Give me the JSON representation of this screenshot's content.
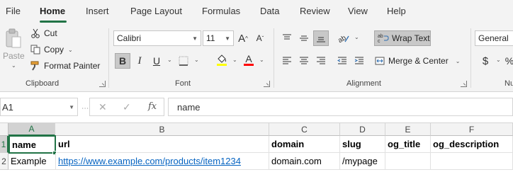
{
  "menu": {
    "tabs": [
      "File",
      "Home",
      "Insert",
      "Page Layout",
      "Formulas",
      "Data",
      "Review",
      "View",
      "Help"
    ],
    "active": "Home"
  },
  "clipboard": {
    "paste": "Paste",
    "cut": "Cut",
    "copy": "Copy",
    "format_painter": "Format Painter",
    "label": "Clipboard"
  },
  "font": {
    "family": "Calibri",
    "size": "11",
    "grow": "A",
    "shrink": "A",
    "bold": "B",
    "italic": "I",
    "underline": "U",
    "font_color_letter": "A",
    "label": "Font",
    "highlight_color": "#ffff00",
    "font_color": "#ff0000"
  },
  "alignment": {
    "wrap_text": "Wrap Text",
    "merge_center": "Merge & Center",
    "label": "Alignment"
  },
  "number": {
    "format": "General",
    "currency_symbol": "$",
    "label_partial": "Nu"
  },
  "formula_bar": {
    "cell_ref": "A1",
    "fx": "fx",
    "content": "name"
  },
  "sheet": {
    "columns": [
      "A",
      "B",
      "C",
      "D",
      "E",
      "F"
    ],
    "rows": [
      "1",
      "2"
    ],
    "data": [
      [
        "name",
        "url",
        "domain",
        "slug",
        "og_title",
        "og_description"
      ],
      [
        "Example",
        "https://www.example.com/products/item1234",
        "domain.com",
        "/mypage",
        "",
        ""
      ]
    ],
    "selected_cell": "A1"
  },
  "colors": {
    "accent": "#217346",
    "link": "#0563c1",
    "ribbon_bg": "#f3f3f3"
  }
}
